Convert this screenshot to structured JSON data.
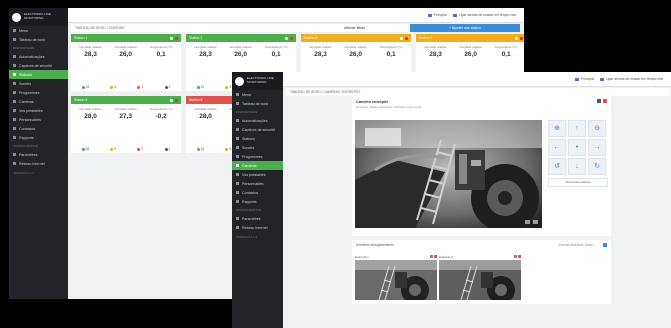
{
  "brand": {
    "line1": "ELECTRONIC LINE",
    "line2": "MONITORING"
  },
  "topbar": {
    "user": "Principal",
    "notification": "Ligar alertas de estado em tempo real"
  },
  "sidebar": {
    "main": [
      {
        "label": "Menu",
        "icon": "menu-icon"
      },
      {
        "label": "Tableau de bord",
        "icon": "dashboard-icon"
      }
    ],
    "category": "DISPOSITIVOS",
    "items": [
      {
        "label": "Automatizações",
        "icon": "automation-icon"
      },
      {
        "label": "Capteurs de sécurité",
        "icon": "sensor-icon"
      },
      {
        "label": "Stations",
        "icon": "station-icon"
      },
      {
        "label": "Sondes",
        "icon": "probe-icon"
      },
      {
        "label": "Programmes",
        "icon": "program-icon"
      },
      {
        "label": "Caméras",
        "icon": "camera-icon"
      },
      {
        "label": "Vos préalables",
        "icon": "prealable-icon"
      },
      {
        "label": "Personnalités",
        "icon": "person-icon"
      },
      {
        "label": "Contactos",
        "icon": "contact-icon"
      },
      {
        "label": "Rapports",
        "icon": "report-icon"
      }
    ],
    "category2": "CONFIGURATION",
    "items2": [
      {
        "label": "Paramètres",
        "icon": "settings-icon"
      },
      {
        "label": "Réseau Internet",
        "icon": "network-icon"
      }
    ],
    "footer": "VERSION 2.1.3"
  },
  "w1": {
    "breadcrumb": "TABLEAU DE BORD / STATIONS",
    "filter_label": "Afficher filtres",
    "add_label": "+ Ajouter une station",
    "metric_labels": [
      "Humidité relative",
      "Humidité relative",
      "Température (°C)"
    ],
    "cards": [
      {
        "name": "Station 1",
        "color": "#4cae4c",
        "values": [
          "28,3",
          "26,0",
          "0,1"
        ],
        "counts": [
          "24",
          "6",
          "1",
          "2"
        ]
      },
      {
        "name": "Station 2",
        "color": "#4cae4c",
        "values": [
          "28,3",
          "26,0",
          "0,1"
        ],
        "counts": [
          "22",
          "5",
          "1",
          "2"
        ]
      },
      {
        "name": "Station 3",
        "color": "#f0ad1e",
        "values": [
          "28,3",
          "26,0",
          "0,1"
        ],
        "counts": [
          "24",
          "6",
          "1",
          "2"
        ]
      },
      {
        "name": "Station 4",
        "color": "#f0ad1e",
        "values": [
          "28,3",
          "26,0",
          "0,1"
        ],
        "counts": [
          "24",
          "6",
          "1",
          "2"
        ]
      },
      {
        "name": "Station 5",
        "color": "#4cae4c",
        "values": [
          "28,0",
          "27,3",
          "-0,2"
        ],
        "counts": [
          "18",
          "6",
          "2",
          "1"
        ]
      },
      {
        "name": "Station 6",
        "color": "#e0524f",
        "values": [
          "28,0",
          "27,3",
          "-0,2"
        ],
        "counts": [
          "16",
          "5",
          "1",
          "2"
        ]
      }
    ]
  },
  "w2": {
    "breadcrumb": "TABLEAU DE BORD / CAMÉRAS / ENTREPÔT",
    "camera_title": "Caméra entrepôt",
    "camera_sub": "En direct / Station Entrepôt / Dernière mise à jour",
    "ptz_link": "Voir preset caméra",
    "recordings_title": "Dernières enregistrements",
    "recordings_extra": "Dernier détection 15min",
    "thumbs": [
      {
        "label": "Entrepôt 1"
      },
      {
        "label": "Entrepôt 2"
      }
    ]
  },
  "status_colors": {
    "ok": "#4cae4c",
    "warning": "#f0ad1e",
    "alarm": "#e0524f",
    "off": "#555555"
  },
  "accent": "#3d8bd9"
}
